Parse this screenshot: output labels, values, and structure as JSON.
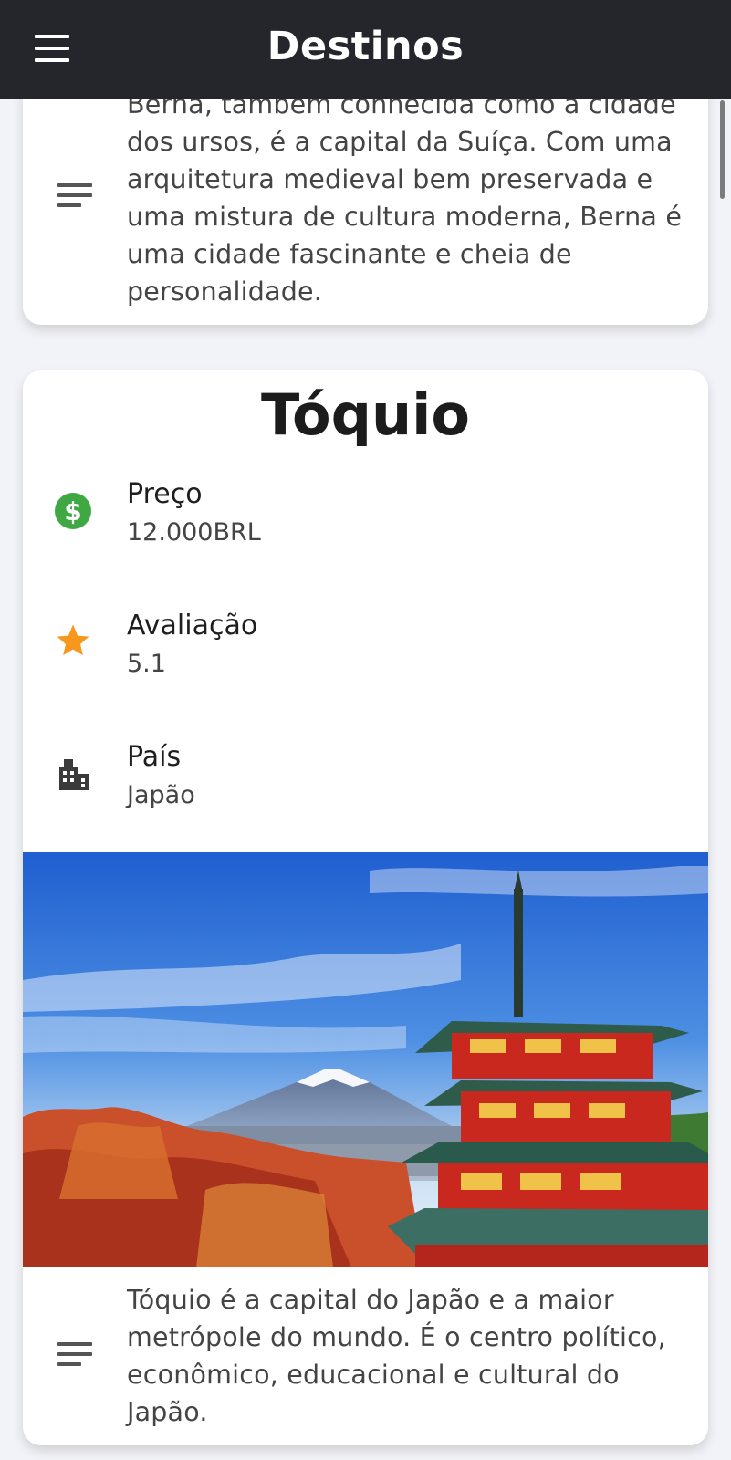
{
  "appbar": {
    "title": "Destinos",
    "menu_icon": "menu-icon"
  },
  "previous_card": {
    "description_icon": "notes-icon",
    "description_lines": [
      "Berna, também conhecida como a cidade",
      "dos ursos, é a capital da Suíça. Com uma",
      "arquitetura medieval bem preservada e",
      "uma mistura de cultura moderna, Berna é",
      "uma cidade fascinante e cheia de",
      "personalidade."
    ]
  },
  "destination_card": {
    "title": "Tóquio",
    "price": {
      "icon": "dollar-circle-icon",
      "label": "Preço",
      "value": "12.000BRL",
      "color": "#3fa843"
    },
    "rating": {
      "icon": "star-icon",
      "label": "Avaliação",
      "value": "5.1",
      "color": "#f7971e"
    },
    "country": {
      "icon": "city-icon",
      "label": "País",
      "value": "Japão"
    },
    "image_icon": "landscape-photo",
    "description_icon": "notes-icon",
    "description_lines": [
      "Tóquio é a capital do Japão e a maior",
      "metrópole do mundo. É o centro político,",
      "econômico, educacional e cultural do",
      "Japão."
    ]
  }
}
